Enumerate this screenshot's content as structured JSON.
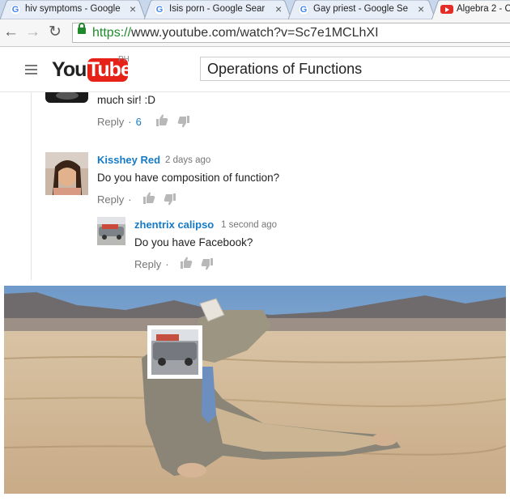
{
  "browser": {
    "tabs": [
      {
        "label": "hiv symptoms - Google",
        "favicon": "google-icon"
      },
      {
        "label": "Isis porn - Google Sear",
        "favicon": "google-icon"
      },
      {
        "label": "Gay priest - Google Se",
        "favicon": "google-icon"
      },
      {
        "label": "Algebra 2 - C",
        "favicon": "youtube-icon"
      }
    ],
    "close_glyph": "×",
    "url_proto": "https://",
    "url_rest": "www.youtube.com/watch?v=Sc7e1MCLhXI"
  },
  "youtube": {
    "logo_you": "You",
    "logo_tube": "Tube",
    "country": "PH",
    "search_value": "Operations of Functions"
  },
  "comments": {
    "first": {
      "text": "much sir! :D",
      "reply_label": "Reply",
      "likes": "6"
    },
    "second": {
      "author": "Kisshey Red",
      "time": "2 days ago",
      "text": "Do you have composition of function?",
      "reply_label": "Reply"
    },
    "reply": {
      "author": "zhentrix calipso",
      "time": "1 second ago",
      "text": "Do you have Facebook?",
      "reply_label": "Reply"
    }
  },
  "colors": {
    "link_blue": "#167ac6",
    "youtube_red": "#e62117",
    "secure_green": "#1e8a2b"
  }
}
